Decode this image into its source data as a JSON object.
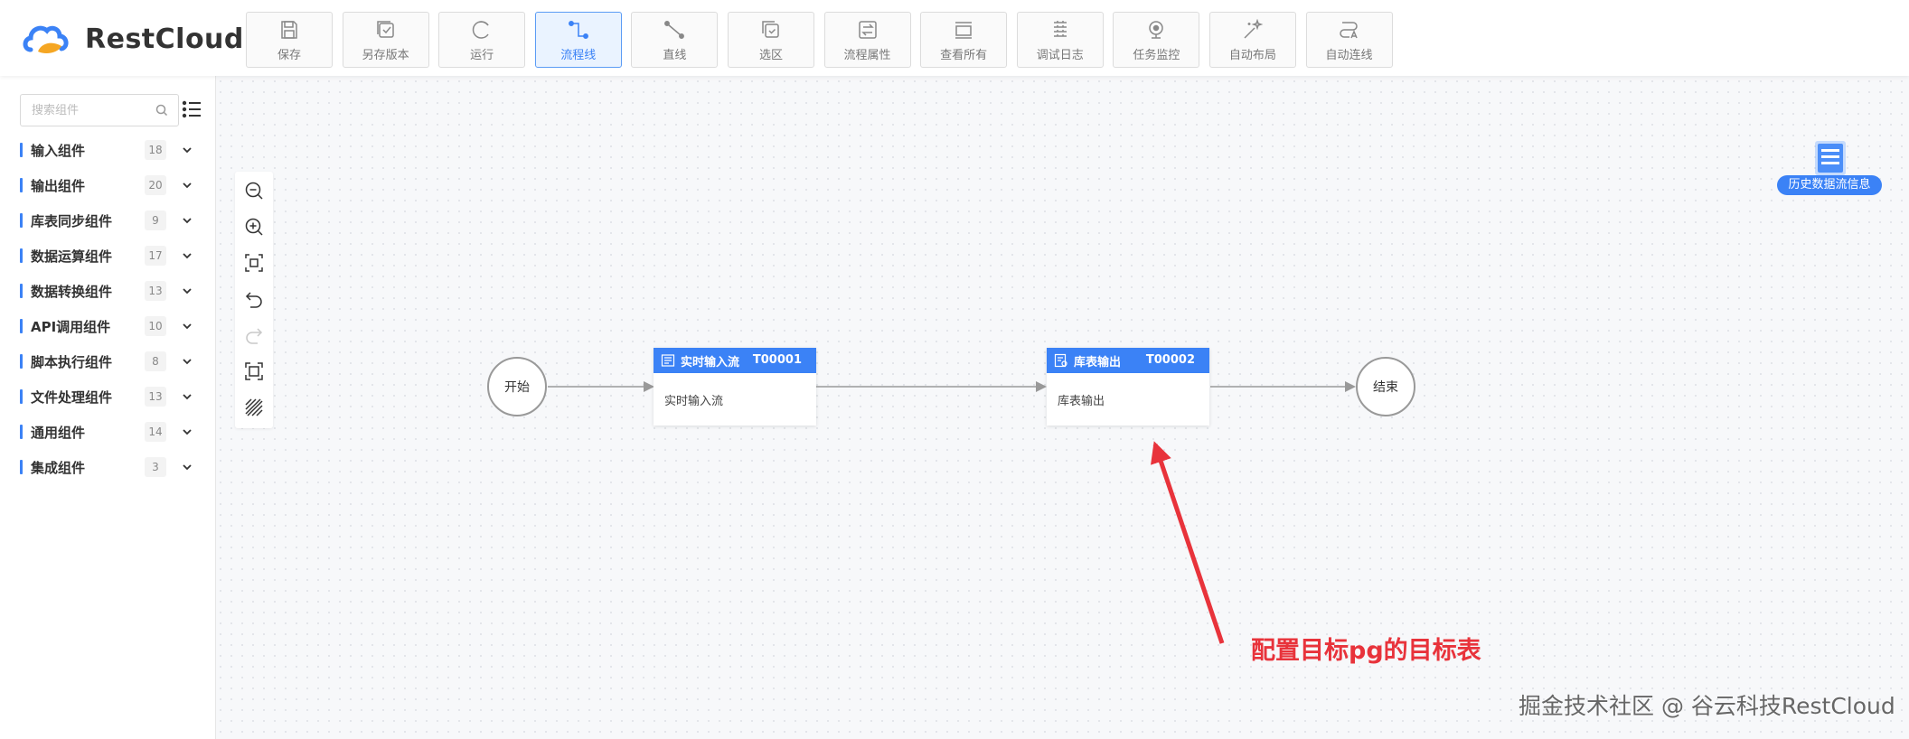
{
  "app": {
    "name": "RestCloud"
  },
  "toolbar": [
    {
      "label": "保存",
      "icon": "save-icon",
      "active": false
    },
    {
      "label": "另存版本",
      "icon": "save-version-icon",
      "active": false
    },
    {
      "label": "运行",
      "icon": "run-icon",
      "active": false
    },
    {
      "label": "流程线",
      "icon": "flow-line-icon",
      "active": true
    },
    {
      "label": "直线",
      "icon": "straight-line-icon",
      "active": false
    },
    {
      "label": "选区",
      "icon": "selection-icon",
      "active": false
    },
    {
      "label": "流程属性",
      "icon": "flow-properties-icon",
      "active": false
    },
    {
      "label": "查看所有",
      "icon": "view-all-icon",
      "active": false
    },
    {
      "label": "调试日志",
      "icon": "debug-log-icon",
      "active": false
    },
    {
      "label": "任务监控",
      "icon": "task-monitor-icon",
      "active": false
    },
    {
      "label": "自动布局",
      "icon": "auto-layout-icon",
      "active": false
    },
    {
      "label": "自动连线",
      "icon": "auto-connect-icon",
      "active": false
    }
  ],
  "sidebar": {
    "search_placeholder": "搜索组件",
    "categories": [
      {
        "label": "输入组件",
        "count": "18"
      },
      {
        "label": "输出组件",
        "count": "20"
      },
      {
        "label": "库表同步组件",
        "count": "9"
      },
      {
        "label": "数据运算组件",
        "count": "17"
      },
      {
        "label": "数据转换组件",
        "count": "13"
      },
      {
        "label": "API调用组件",
        "count": "10"
      },
      {
        "label": "脚本执行组件",
        "count": "8"
      },
      {
        "label": "文件处理组件",
        "count": "13"
      },
      {
        "label": "通用组件",
        "count": "14"
      },
      {
        "label": "集成组件",
        "count": "3"
      }
    ]
  },
  "canvas": {
    "start_node": {
      "label": "开始"
    },
    "end_node": {
      "label": "结束"
    },
    "tasks": [
      {
        "title": "实时输入流",
        "id": "T00001",
        "body": "实时输入流"
      },
      {
        "title": "库表输出",
        "id": "T00002",
        "body": "库表输出"
      }
    ],
    "history_button": {
      "label": "历史数据流信息"
    },
    "annotation": "配置目标pg的目标表",
    "watermark": "掘金技术社区 @ 谷云科技RestCloud"
  },
  "colors": {
    "primary": "#3b82f6",
    "annotation": "#e8333b",
    "canvas_bg": "#f7f8fa"
  }
}
